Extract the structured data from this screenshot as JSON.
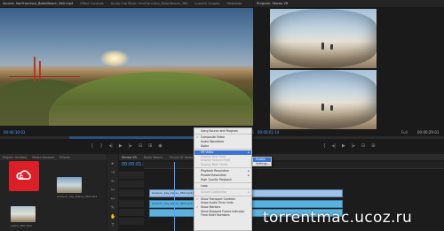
{
  "source_monitor": {
    "tabs": [
      "Source: SanFrancisco_BakerBeach_360.mp4",
      "Effect Controls",
      "Audio Clip Mixer: SanFrancisco_BakerBeach_360",
      "Lumetri Scopes",
      "Metadata"
    ],
    "timecode": "00:00:10:03",
    "duration": "00:00:55:19"
  },
  "program_monitor": {
    "tab": "Program: Stereo VR",
    "timecode": "00:00:01:14",
    "fit_label": "Full",
    "duration": "00:00:29:01"
  },
  "project_panel": {
    "tabs": [
      "Project: Untitled",
      "Media Browser",
      "Libraries",
      "Info",
      "Effects"
    ],
    "logo_name": "adobe-creative-cloud",
    "logo_color": "#da1f26",
    "thumb_label": "kowloon_bay_stereo_360.mp4",
    "thumb2_label": "osaka_360.mp4"
  },
  "timeline": {
    "tabs": [
      "Stereo VR",
      "Baker Beach",
      "Prince Of Wales",
      "Mono VR"
    ],
    "timecode": "00:00:01:14",
    "clips": [
      {
        "label": "kowloon_bay_stereo_360.mp4 [V]"
      },
      {
        "label": "kowloon_bay_stereo_360.mp4 [A]"
      }
    ]
  },
  "context_menu": {
    "items": [
      {
        "label": "Gang Source and Program",
        "checked": false,
        "disabled": false
      },
      {
        "label": "Composite Video",
        "checked": true,
        "disabled": false,
        "sep_before": true
      },
      {
        "label": "Audio Waveform",
        "checked": false,
        "disabled": false
      },
      {
        "label": "Alpha",
        "checked": false,
        "disabled": false
      },
      {
        "label": "VR Video",
        "checked": false,
        "disabled": false,
        "submenu": true,
        "selected": true,
        "sep_before": true
      },
      {
        "label": "Display First Field",
        "checked": false,
        "disabled": true
      },
      {
        "label": "Display Second Field",
        "checked": false,
        "disabled": true
      },
      {
        "label": "Display Both Fields",
        "checked": false,
        "disabled": true
      },
      {
        "label": "Playback Resolution",
        "checked": false,
        "disabled": false,
        "submenu": true,
        "sep_before": true
      },
      {
        "label": "Paused Resolution",
        "checked": false,
        "disabled": false,
        "submenu": true
      },
      {
        "label": "High Quality Playback",
        "checked": false,
        "disabled": false
      },
      {
        "label": "Loop",
        "checked": false,
        "disabled": false,
        "sep_before": true
      },
      {
        "label": "Closed Captioning",
        "checked": false,
        "disabled": true,
        "submenu": true,
        "sep_before": true
      },
      {
        "label": "Show Transport Controls",
        "checked": true,
        "disabled": false,
        "sep_before": true
      },
      {
        "label": "Show Audio Time Units",
        "checked": false,
        "disabled": false
      },
      {
        "label": "Show Markers",
        "checked": true,
        "disabled": false
      },
      {
        "label": "Show Dropped Frame Indicator",
        "checked": false,
        "disabled": false
      },
      {
        "label": "Time Ruler Numbers",
        "checked": false,
        "disabled": false
      }
    ],
    "submenu": {
      "items": [
        {
          "label": "Enable",
          "selected": true
        },
        {
          "label": "Settings...",
          "selected": false
        }
      ]
    }
  },
  "watermark": "torrentmac.ucoz.ru"
}
